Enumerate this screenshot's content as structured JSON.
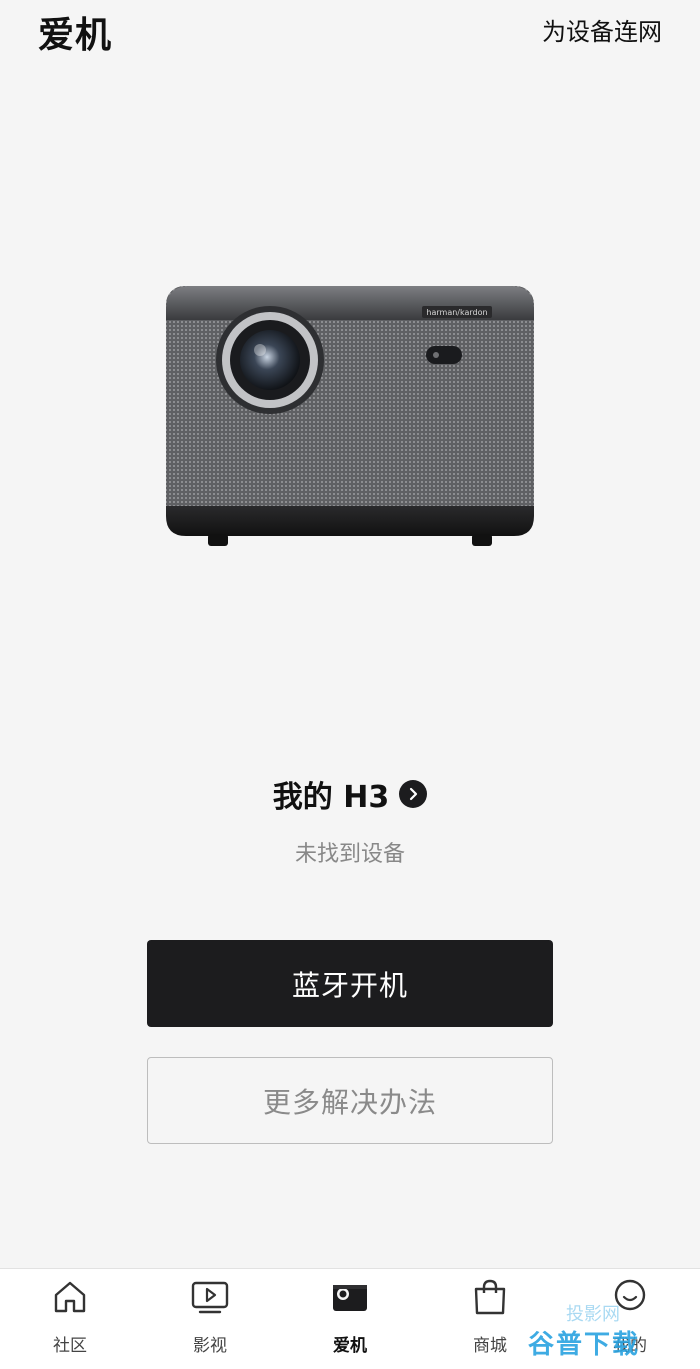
{
  "header": {
    "title": "爱机",
    "connect_label": "为设备连网"
  },
  "device": {
    "brand_label": "harman/kardon",
    "name": "我的 H3",
    "status": "未找到设备"
  },
  "actions": {
    "primary_label": "蓝牙开机",
    "secondary_label": "更多解决办法"
  },
  "tabbar": {
    "items": [
      {
        "label": "社区",
        "icon": "home-icon"
      },
      {
        "label": "影视",
        "icon": "play-icon"
      },
      {
        "label": "爱机",
        "icon": "projector-icon"
      },
      {
        "label": "商城",
        "icon": "shopping-bag-icon"
      },
      {
        "label": "我的",
        "icon": "smiley-icon"
      }
    ],
    "active_index": 2
  },
  "watermark": {
    "text": "谷普下载",
    "top_text": "投影网"
  },
  "colors": {
    "background": "#f5f5f5",
    "primary_button": "#1c1c1e",
    "watermark": "#2aa3e0"
  }
}
